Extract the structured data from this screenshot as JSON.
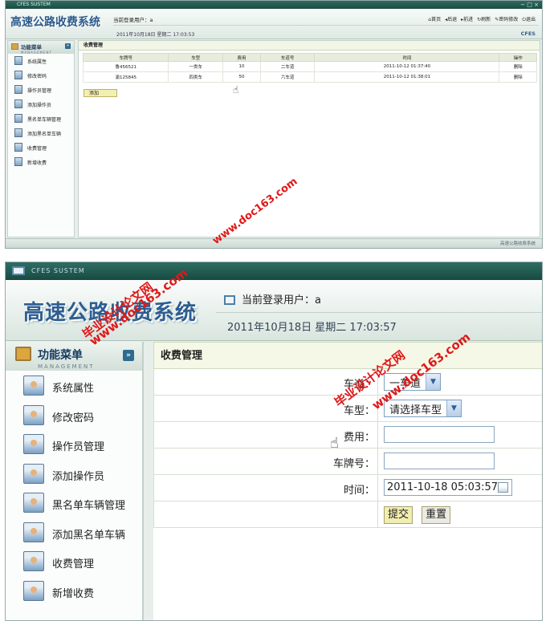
{
  "top": {
    "window_title": "CFES SUSTEM",
    "window_controls": "− □ ×",
    "app_title": "高速公路收费系统",
    "user_label": "当前登录用户：a",
    "date": "2011年10月18日 星期二 17:03:53",
    "nav": [
      "首页",
      "后退",
      "前进",
      "刷新",
      "密码修改",
      "退出"
    ],
    "brand": "CFES",
    "menu_title": "功能菜单",
    "menu_sub": "MANAGEMENT",
    "menu": [
      "系统属性",
      "修改密码",
      "操作员管理",
      "添加操作员",
      "黑名单车辆管理",
      "添加黑名单车辆",
      "收费管理",
      "新增收费"
    ],
    "panel_title": "收费管理",
    "columns": [
      "车牌号",
      "车型",
      "费用",
      "车道号",
      "时间",
      "操作"
    ],
    "rows": [
      [
        "鲁456521",
        "一类车",
        "10",
        "二车道",
        "2011-10-12 01:37:40",
        "删除"
      ],
      [
        "渝125845",
        "四类车",
        "50",
        "六车道",
        "2011-10-12 01:38:01",
        "删除"
      ]
    ],
    "add_label": "添加",
    "footer": "高速公路收费系统"
  },
  "bottom": {
    "window_title": "CFES SUSTEM",
    "app_title": "高速公路收费系统",
    "user_label": "当前登录用户：a",
    "date": "2011年10月18日  星期二  17:03:57",
    "menu_title": "功能菜单",
    "menu_sub": "MANAGEMENT",
    "menu": [
      "系统属性",
      "修改密码",
      "操作员管理",
      "添加操作员",
      "黑名单车辆管理",
      "添加黑名单车辆",
      "收费管理",
      "新增收费"
    ],
    "panel_title": "收费管理",
    "form": {
      "lane_label": "车道：",
      "lane_value": "一车道",
      "type_label": "车型：",
      "type_value": "请选择车型",
      "fee_label": "费用：",
      "plate_label": "车牌号：",
      "time_label": "时间：",
      "time_value": "2011-10-18 05:03:57"
    },
    "submit_label": "提交",
    "reset_label": "重置"
  },
  "watermarks": {
    "site": "www.doc163.com",
    "cn": "毕业设计论文网"
  }
}
